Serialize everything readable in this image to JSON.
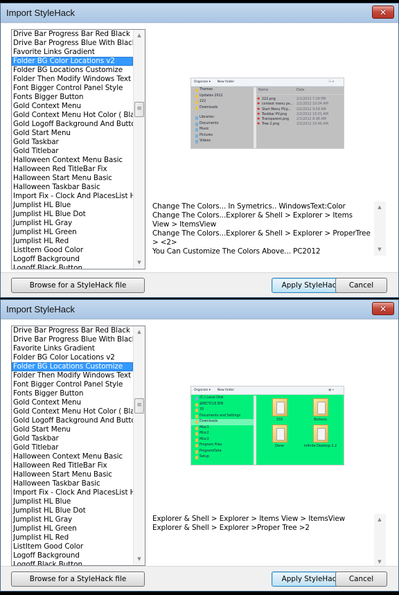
{
  "windows": [
    {
      "title": "Import StyleHack",
      "close_icon": "close-x-icon",
      "list": {
        "items": [
          "Drive Bar Progress Bar Red Black BG",
          "Drive Bar Progress Blue With Black BG",
          "Favorite Links Gradient",
          "Folder BG Color Locations v2",
          "Folder BG Locations Customize",
          "Folder Then Modify Windows Text Color",
          "Font Bigger Control Panel Style",
          "Fonts Bigger Button",
          "Gold Context Menu",
          "Gold Context Menu Hot Color ( Black",
          "Gold Logoff Background And Button",
          "Gold Start Menu",
          "Gold Taskbar",
          "Gold Titlebar",
          "Halloween Context Menu Basic",
          "Halloween Red TitleBar Fix",
          "Halloween Start Menu Basic",
          "Halloween Taskbar Basic",
          "Import Fix - Clock And PlacesList Hover",
          "Jumplist HL Blue",
          "Jumplist HL Blue Dot",
          "Jumplist HL Gray",
          "Jumplist HL Green",
          "Jumplist HL Red",
          "ListItem Good Color",
          "Logoff Background",
          "Logoff Black Button"
        ],
        "selected_index": 3,
        "selected_label": "Folder BG Color Locations v2",
        "scroll_position": 0.3
      },
      "preview": {
        "toolbar": [
          "Organize ▾",
          "New folder"
        ],
        "nav": [
          {
            "label": "Themes",
            "type": "folder"
          },
          {
            "label": "Updates 2012",
            "type": "folder"
          },
          {
            "label": "222",
            "type": "folder"
          },
          {
            "label": "Downloads",
            "type": "folder"
          },
          {
            "label": "",
            "type": "gap"
          },
          {
            "label": "Libraries",
            "type": "lib"
          },
          {
            "label": "Documents",
            "type": "lib"
          },
          {
            "label": "Music",
            "type": "lib"
          },
          {
            "label": "Pictures",
            "type": "lib"
          },
          {
            "label": "Videos",
            "type": "lib"
          }
        ],
        "columns": [
          "Name",
          "Date"
        ],
        "files": [
          {
            "name": "222.png",
            "date": "2/1/2012 7:29 PM"
          },
          {
            "name": "context menu pv...",
            "date": "2/2/2012 10:04 AM"
          },
          {
            "name": "Start Menu PV.p...",
            "date": "2/2/2012 9:59 AM"
          },
          {
            "name": "Taskbar PV.png",
            "date": "2/2/2012 10:01 AM"
          },
          {
            "name": "Transparent.png",
            "date": "2/1/2012 8:38 AM"
          },
          {
            "name": "Tree 2.png",
            "date": "2/2/2012 10:46 AM"
          }
        ],
        "background_color": "#c0c0c0"
      },
      "description": [
        "Change The Colors... In Symetrics.. WindowsText:Color",
        "Change The Colors...Explorer & Shell > Explorer > Items View > ItemsView",
        "Change The Colors...Explorer & Shell > Explorer > ProperTree > <2>",
        "You Can Customize The Colors Above... PC2012"
      ],
      "buttons": {
        "browse": "Browse for a StyleHack file",
        "apply": "Apply StyleHack",
        "cancel": "Cancel"
      }
    },
    {
      "title": "Import StyleHack",
      "close_icon": "close-x-icon",
      "list": {
        "items": [
          "Drive Bar Progress Bar Red Black BG",
          "Drive Bar Progress Blue With Black BG",
          "Favorite Links Gradient",
          "Folder BG Color Locations v2",
          "Folder BG Locations Customize",
          "Folder Then Modify Windows Text Color",
          "Font Bigger Control Panel Style",
          "Fonts Bigger Button",
          "Gold Context Menu",
          "Gold Context Menu Hot Color ( Black",
          "Gold Logoff Background And Button",
          "Gold Start Menu",
          "Gold Taskbar",
          "Gold Titlebar",
          "Halloween Context Menu Basic",
          "Halloween Red TitleBar Fix",
          "Halloween Start Menu Basic",
          "Halloween Taskbar Basic",
          "Import Fix - Clock And PlacesList Hover",
          "Jumplist HL Blue",
          "Jumplist HL Blue Dot",
          "Jumplist HL Gray",
          "Jumplist HL Green",
          "Jumplist HL Red",
          "ListItem Good Color",
          "Logoff Background",
          "Logoff Black Button"
        ],
        "selected_index": 4,
        "selected_label": "Folder BG Locations Customize",
        "scroll_position": 0.3
      },
      "preview": {
        "toolbar": [
          "Organize ▾",
          "New folder"
        ],
        "nav": [
          {
            "label": "(C:) Local Disk",
            "type": "lib"
          },
          {
            "label": "$RECYCLE.BIN",
            "type": "folder"
          },
          {
            "label": "33",
            "type": "folder"
          },
          {
            "label": "Documents and Settings",
            "type": "folder"
          },
          {
            "label": "Downloads",
            "type": "folder",
            "highlight": true
          },
          {
            "label": "Misc1",
            "type": "folder"
          },
          {
            "label": "Misc2",
            "type": "folder"
          },
          {
            "label": "Misc3",
            "type": "folder"
          },
          {
            "label": "Program Files",
            "type": "folder"
          },
          {
            "label": "ProgramData",
            "type": "folder"
          },
          {
            "label": "Setup",
            "type": "folder"
          }
        ],
        "folders": [
          "333",
          "Buttons",
          "Done",
          "Infinite Desktop 2.2"
        ],
        "background_color": "#00f07a"
      },
      "description": [
        "Explorer & Shell > Explorer > Items View > ItemsView",
        "Explorer & Shell > Explorer >Proper Tree >2"
      ],
      "buttons": {
        "browse": "Browse for a StyleHack file",
        "apply": "Apply StyleHack",
        "cancel": "Cancel"
      }
    }
  ]
}
